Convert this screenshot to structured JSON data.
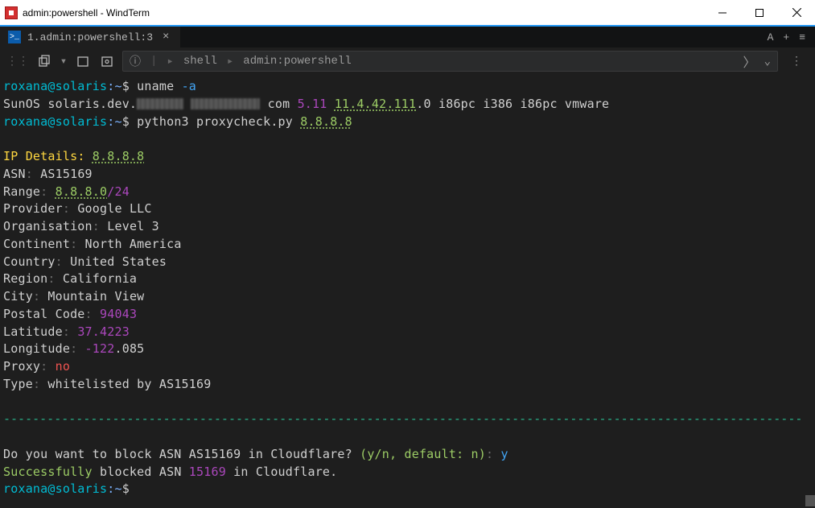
{
  "window": {
    "title": "admin:powershell - WindTerm"
  },
  "tab": {
    "label": "1.admin:powershell:3"
  },
  "tabstrip": {
    "font_indicator": "A",
    "plus": "+",
    "menu": "≡"
  },
  "breadcrumb": {
    "seg1": "shell",
    "seg2": "admin:powershell"
  },
  "prompt": {
    "userhost": "roxana@solaris",
    "tilde": ":~",
    "dollar": "$"
  },
  "cmds": {
    "uname": "uname",
    "uname_flag": "-a",
    "python": "python3 proxycheck.py",
    "ip_arg": "8.8.8.8"
  },
  "uname_out": {
    "prefix": "SunOS solaris.dev.",
    "middle": "com",
    "v1": "5.11",
    "v2": "11.4.42.111",
    "v3": ".0",
    "suffix": " i86pc i386 i86pc vmware"
  },
  "details": {
    "header_key": "IP Details",
    "header_val": "8.8.8.8",
    "asn_key": "ASN",
    "asn_val": "AS15169",
    "range_key": "Range",
    "range_ip": "8.8.8.0",
    "range_cidr": "/24",
    "provider_key": "Provider",
    "provider_val": "Google LLC",
    "org_key": "Organisation",
    "org_val": "Level 3",
    "continent_key": "Continent",
    "continent_val": "North America",
    "country_key": "Country",
    "country_val": "United States",
    "region_key": "Region",
    "region_val": "California",
    "city_key": "City",
    "city_val": "Mountain View",
    "postal_key": "Postal Code",
    "postal_val": "94043",
    "lat_key": "Latitude",
    "lat_val": "37.4223",
    "lon_key": "Longitude",
    "lon_neg": "-122",
    "lon_rest": ".085",
    "proxy_key": "Proxy",
    "proxy_val": "no",
    "type_key": "Type",
    "type_val": "whitelisted by AS15169"
  },
  "dashes": "--------------------------------------------------------------------------------------------------------------",
  "question": {
    "text": "Do you want to block ASN AS15169 in Cloudflare?",
    "hint": "(y/n, default: n)",
    "answer": "y"
  },
  "result": {
    "success": "Successfully",
    "mid1": " blocked ASN ",
    "asn": "15169",
    "mid2": " in Cloudflare."
  }
}
